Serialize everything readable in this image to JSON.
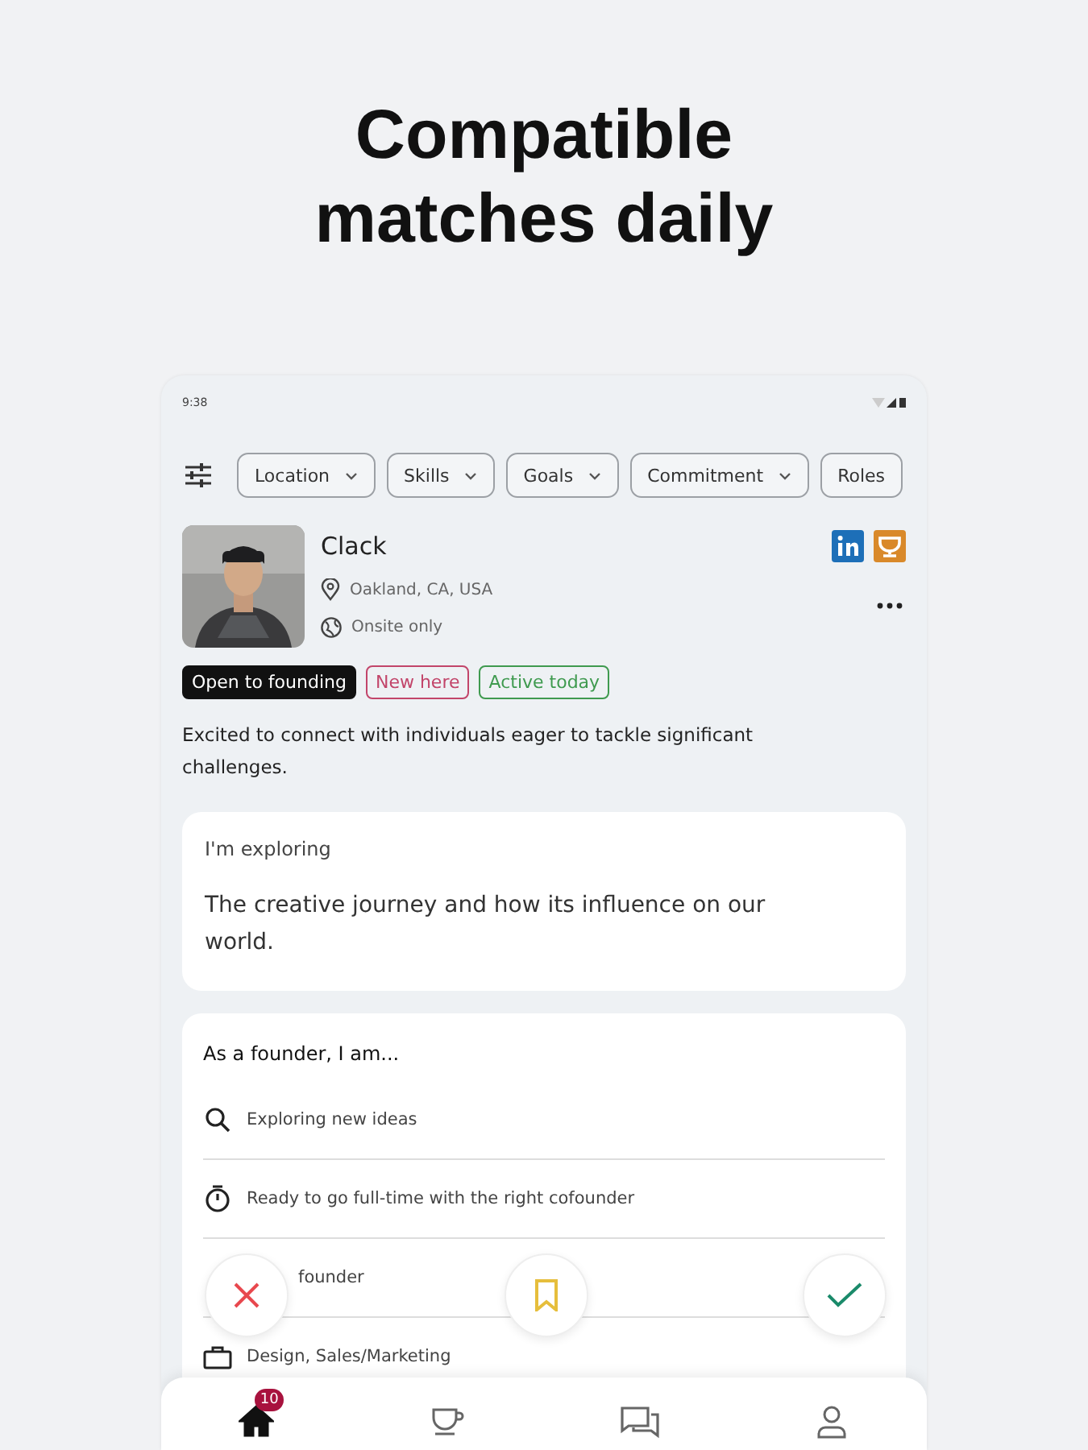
{
  "headline": "Compatible matches daily",
  "status_bar": {
    "time": "9:38"
  },
  "filters": [
    {
      "label": "Location"
    },
    {
      "label": "Skills"
    },
    {
      "label": "Goals"
    },
    {
      "label": "Commitment"
    },
    {
      "label": "Roles"
    }
  ],
  "profile": {
    "name": "Clack",
    "location": "Oakland, CA, USA",
    "work_mode": "Onsite only"
  },
  "tags": [
    {
      "label": "Open to founding",
      "kind": "filled",
      "color": "#111111"
    },
    {
      "label": "New here",
      "kind": "outlined",
      "color": "#c2456a"
    },
    {
      "label": "Active today",
      "kind": "outlined",
      "color": "#3f9a4f"
    }
  ],
  "bio": "Excited to connect with individuals eager to tackle significant challenges.",
  "exploring": {
    "title": "I'm exploring",
    "text": "The creative journey and how its influence on our world."
  },
  "founder": {
    "title": "As a founder, I am...",
    "items": [
      {
        "kind": "search",
        "text": "Exploring new ideas"
      },
      {
        "kind": "timer",
        "text": "Ready to go full-time with the right cofounder"
      },
      {
        "kind": "hidden",
        "text": "founder"
      },
      {
        "kind": "briefcase",
        "text": "Design, Sales/Marketing"
      }
    ]
  },
  "actions": [
    {
      "kind": "pass"
    },
    {
      "kind": "save"
    },
    {
      "kind": "like"
    }
  ],
  "nav": [
    {
      "kind": "home",
      "selected": true,
      "badge": "10"
    },
    {
      "kind": "cup",
      "selected": false
    },
    {
      "kind": "chat",
      "selected": false
    },
    {
      "kind": "person",
      "selected": false
    }
  ]
}
